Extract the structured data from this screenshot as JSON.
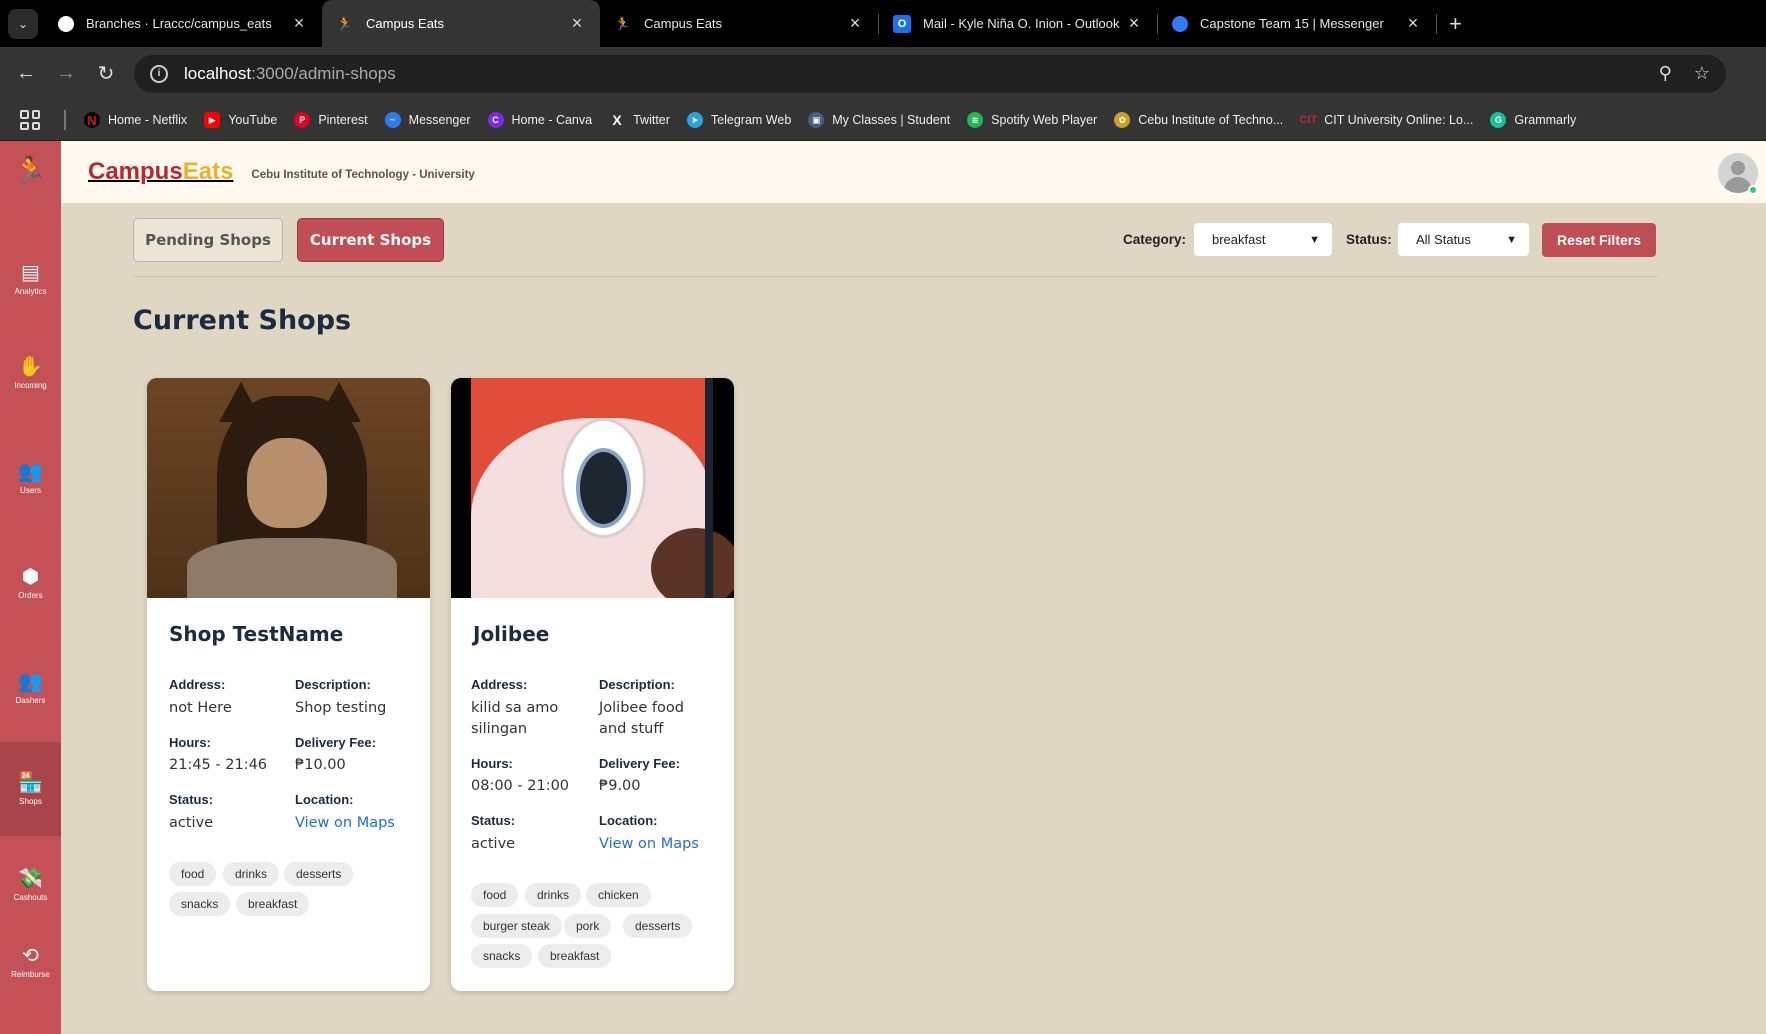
{
  "browser": {
    "tabs": [
      {
        "title": "Branches · Lraccc/campus_eats",
        "icon": "github-icon",
        "color": "#ffffff"
      },
      {
        "title": "Campus Eats",
        "icon": "runner-icon",
        "color": "#d94b51"
      },
      {
        "title": "Campus Eats",
        "icon": "runner-icon",
        "color": "#d94b51"
      },
      {
        "title": "Mail - Kyle Niña O. Inion - Outlook",
        "icon": "outlook-icon",
        "color": "#1a73e8"
      },
      {
        "title": "Capstone Team 15 | Messenger",
        "icon": "messenger-icon",
        "color": "#2e7bf6"
      }
    ],
    "url_host": "localhost",
    "url_path": ":3000/admin-shops",
    "bookmarks": [
      {
        "label": "Home - Netflix",
        "icon": "netflix-icon",
        "color": "#e50914"
      },
      {
        "label": "YouTube",
        "icon": "youtube-icon",
        "color": "#ff0000"
      },
      {
        "label": "Pinterest",
        "icon": "pinterest-icon",
        "color": "#e60023"
      },
      {
        "label": "Messenger",
        "icon": "messenger-icon",
        "color": "#2e7bf6"
      },
      {
        "label": "Home - Canva",
        "icon": "canva-icon",
        "color": "#7d2ae8"
      },
      {
        "label": "Twitter",
        "icon": "x-icon",
        "color": "#222222"
      },
      {
        "label": "Telegram Web",
        "icon": "telegram-icon",
        "color": "#2aa3df"
      },
      {
        "label": "My Classes | Student",
        "icon": "classes-icon",
        "color": "#4a5a8a"
      },
      {
        "label": "Spotify Web Player",
        "icon": "spotify-icon",
        "color": "#1db954"
      },
      {
        "label": "Cebu Institute of Techno...",
        "icon": "cit-seal-icon",
        "color": "#c9a227"
      },
      {
        "label": "CIT University Online: Lo...",
        "icon": "cit-icon",
        "color": "#b8282e"
      },
      {
        "label": "Grammarly",
        "icon": "grammarly-icon",
        "color": "#15c39a"
      }
    ]
  },
  "sidebar": {
    "items": [
      {
        "label": "Analytics",
        "icon": "analytics-icon"
      },
      {
        "label": "Incoming",
        "icon": "incoming-icon"
      },
      {
        "label": "Users",
        "icon": "users-icon"
      },
      {
        "label": "Orders",
        "icon": "orders-icon"
      },
      {
        "label": "Dashers",
        "icon": "dashers-icon"
      },
      {
        "label": "Shops",
        "icon": "shops-icon",
        "active": true
      },
      {
        "label": "Cashouts",
        "icon": "cashouts-icon"
      },
      {
        "label": "Reimburse",
        "icon": "reimburse-icon"
      }
    ]
  },
  "header": {
    "brand_part1": "Campus",
    "brand_part2": "Eats",
    "subtitle": "Cebu Institute of Technology - University"
  },
  "toolbar": {
    "pending_label": "Pending Shops",
    "current_label": "Current Shops",
    "category_label": "Category:",
    "category_value": "breakfast",
    "status_label": "Status:",
    "status_value": "All Status",
    "reset_label": "Reset Filters"
  },
  "main": {
    "title": "Current Shops",
    "labels": {
      "address": "Address:",
      "description": "Description:",
      "hours": "Hours:",
      "delivery_fee": "Delivery Fee:",
      "status": "Status:",
      "location": "Location:",
      "maps_link": "View on Maps"
    },
    "shops": [
      {
        "name": "Shop TestName",
        "address": "not Here",
        "description": "Shop testing",
        "hours": "21:45 - 21:46",
        "delivery_fee": "₱10.00",
        "status": "active",
        "tags": [
          "food",
          "drinks",
          "desserts",
          "snacks",
          "breakfast"
        ]
      },
      {
        "name": "Jolibee",
        "address": "kilid sa amo silingan",
        "description": "Jolibee food and stuff",
        "hours": "08:00 - 21:00",
        "delivery_fee": "₱9.00",
        "status": "active",
        "tags": [
          "food",
          "drinks",
          "chicken",
          "burger steak",
          "pork",
          "desserts",
          "snacks",
          "breakfast"
        ]
      }
    ]
  }
}
